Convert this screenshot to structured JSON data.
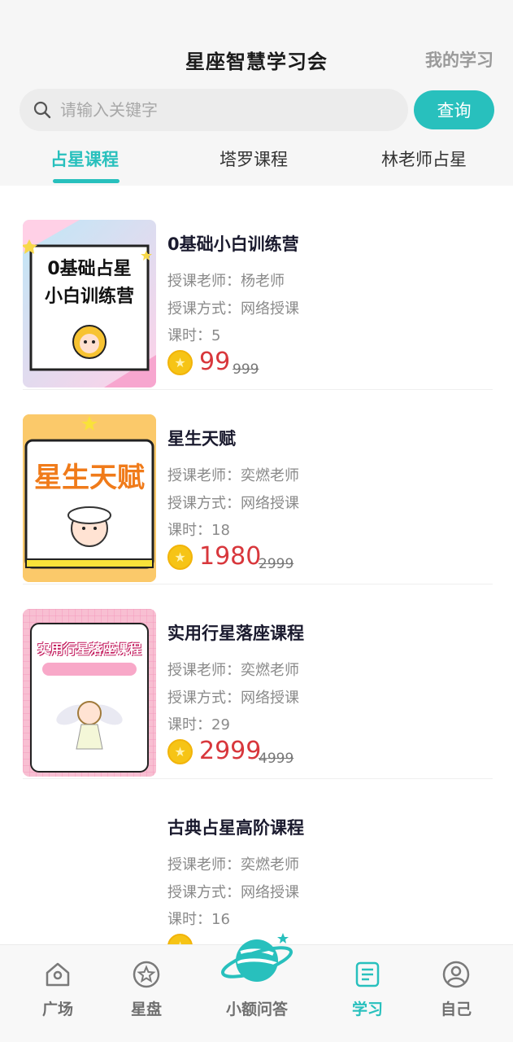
{
  "header": {
    "title": "星座智慧学习会",
    "my_learning": "我的学习"
  },
  "search": {
    "placeholder": "请输入关键字",
    "button": "查询"
  },
  "tabs": [
    {
      "label": "占星课程",
      "active": true
    },
    {
      "label": "塔罗课程",
      "active": false
    },
    {
      "label": "林老师占星",
      "active": false
    }
  ],
  "courses": [
    {
      "title": "0基础小白训练营",
      "teacher": "授课老师：杨老师",
      "mode": "授课方式：网络授课",
      "hours": "课时：5",
      "price": "99",
      "original_price": "999",
      "thumb_text": "0基础占星 小白训练营"
    },
    {
      "title": "星生天赋",
      "teacher": "授课老师：奕燃老师",
      "mode": "授课方式：网络授课",
      "hours": "课时：18",
      "price": "1980",
      "original_price": "2999",
      "thumb_text": "星生天赋"
    },
    {
      "title": "实用行星落座课程",
      "teacher": "授课老师：奕燃老师",
      "mode": "授课方式：网络授课",
      "hours": "课时：29",
      "price": "2999",
      "original_price": "4999",
      "thumb_text": "实用行星落座课程"
    },
    {
      "title": "古典占星高阶课程",
      "teacher": "授课老师：奕燃老师",
      "mode": "授课方式：网络授课",
      "hours": "课时：16",
      "price": "",
      "original_price": ""
    }
  ],
  "bottom_nav": [
    {
      "label": "广场",
      "icon": "home-icon",
      "active": false
    },
    {
      "label": "星盘",
      "icon": "star-icon",
      "active": false
    },
    {
      "label": "小额问答",
      "icon": "planet-icon",
      "active": false
    },
    {
      "label": "学习",
      "icon": "book-icon",
      "active": true
    },
    {
      "label": "自己",
      "icon": "user-icon",
      "active": false
    }
  ],
  "colors": {
    "accent": "#28c0bd",
    "price": "#d8373c",
    "coin": "#f6c416"
  }
}
